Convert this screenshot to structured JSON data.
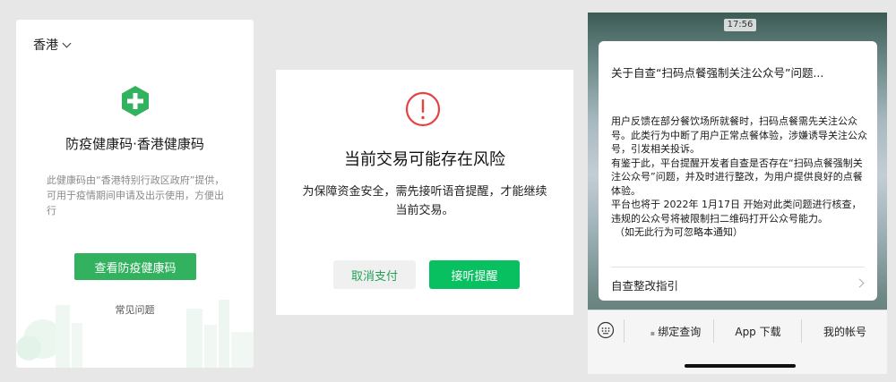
{
  "health_code": {
    "region": "香港",
    "title": "防疫健康码·香港健康码",
    "description": "此健康码由“香港特别行政区政府”提供，可用于疫情期间申请及出示使用，方便出行",
    "view_button": "查看防疫健康码",
    "faq_link": "常见问题",
    "accent_color": "#32b25e"
  },
  "risk_dialog": {
    "title": "当前交易可能存在风险",
    "message_line1": "为保障资金安全，需先接听语音提醒，才能继续",
    "message_line2": "当前交易。",
    "cancel_button": "取消支付",
    "answer_button": "接听提醒",
    "alert_color": "#e64340",
    "accent_color": "#09c060"
  },
  "notice": {
    "status_time": "17:56",
    "title": "关于自查“扫码点餐强制关注公众号”问题...",
    "paragraphs": [
      "用户反馈在部分餐饮场所就餐时，扫码点餐需先关注公众号。此类行为中断了用户正常点餐体验，涉嫌诱导关注公众号，引发相关投诉。",
      "有鉴于此，平台提醒开发者自查是否存在“扫码点餐强制关注公众号”问题，并及时进行整改，为用户提供良好的点餐体验。",
      "平台也将于 2022年 1月17日 开始对此类问题进行核查，违规的公众号将被限制扫二维码打开公众号能力。",
      "（如无此行为可忽略本通知）"
    ],
    "guide_link": "自查整改指引",
    "menu": {
      "item1": "绑定查询",
      "item2": "App 下载",
      "item3": "我的帐号"
    }
  }
}
